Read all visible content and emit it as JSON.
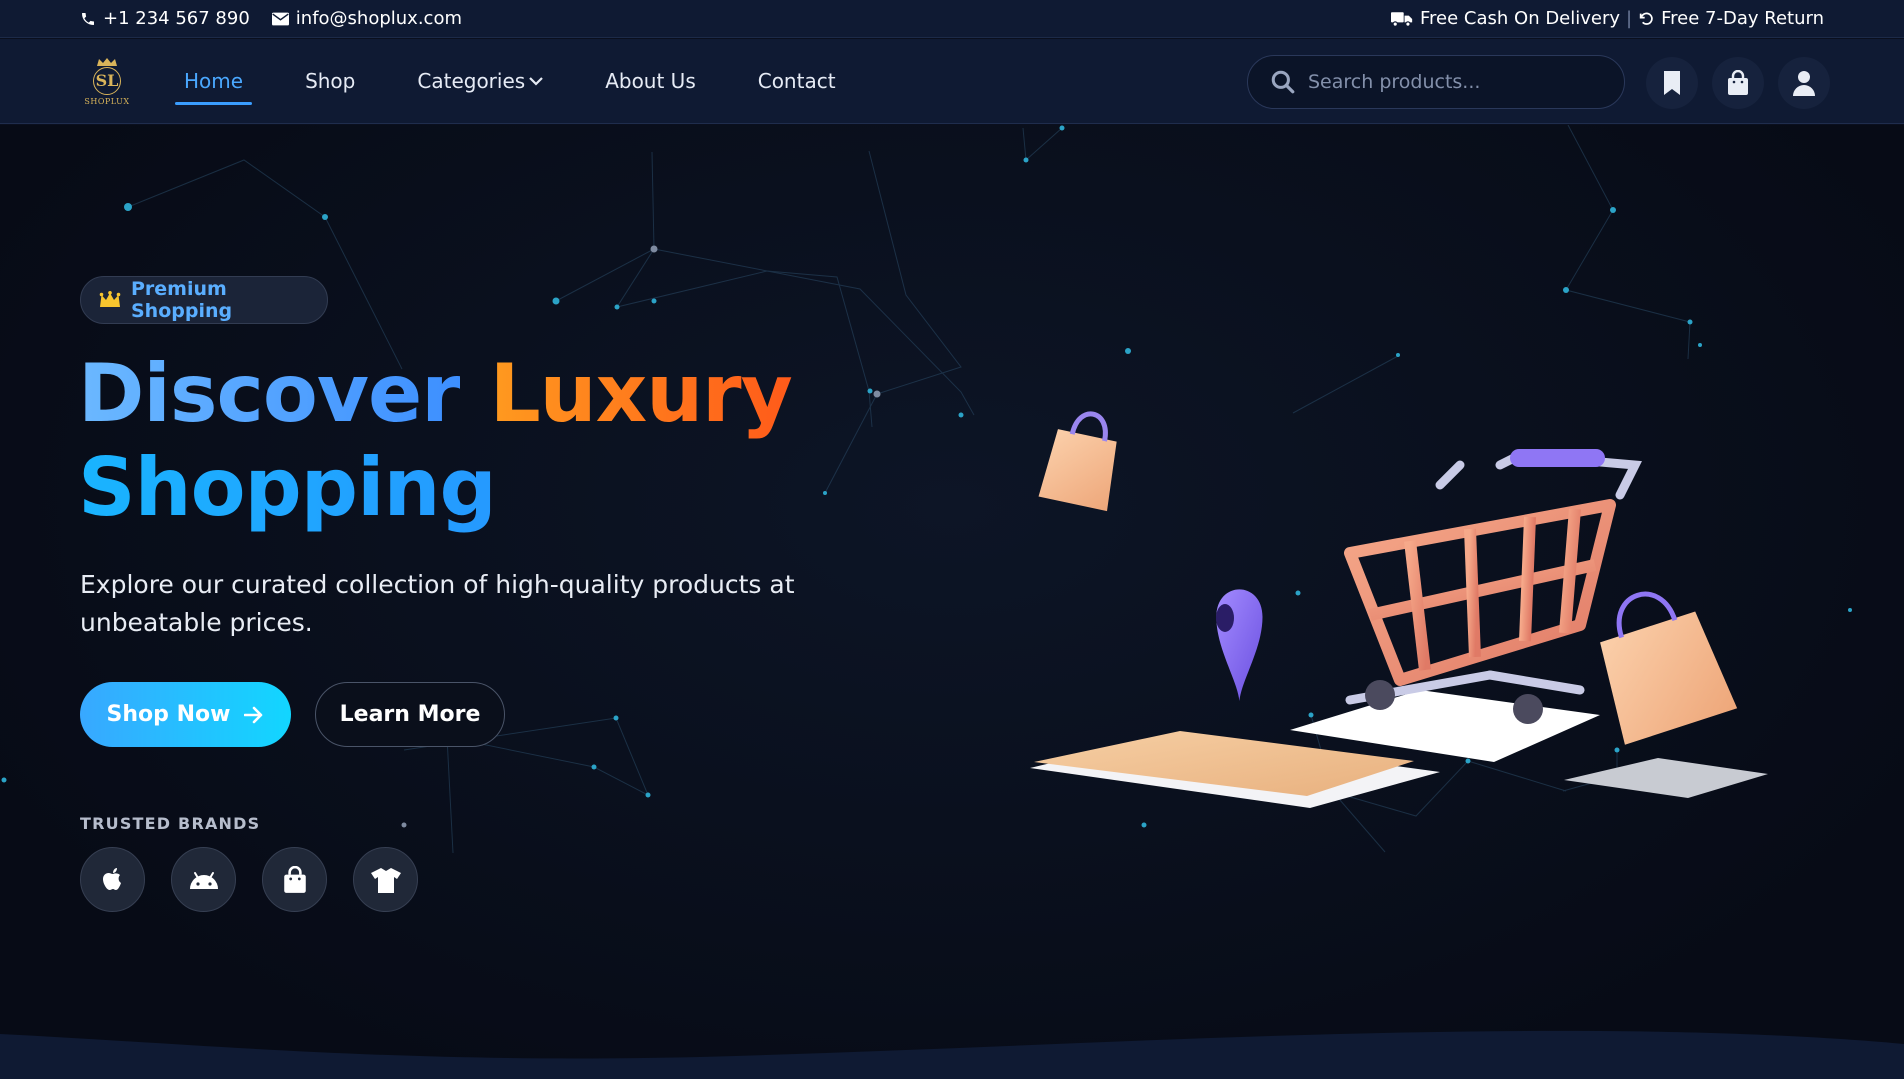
{
  "topbar": {
    "phone": "+1 234 567 890",
    "email": "info@shoplux.com",
    "delivery": "Free Cash On Delivery",
    "divider": "|",
    "return": "Free 7-Day Return"
  },
  "brand": {
    "logo_mark": "SL",
    "logo_text": "SHOPLUX"
  },
  "nav": {
    "items": [
      {
        "label": "Home",
        "active": true
      },
      {
        "label": "Shop"
      },
      {
        "label": "Categories",
        "has_dropdown": true
      },
      {
        "label": "About Us"
      },
      {
        "label": "Contact"
      }
    ],
    "search_placeholder": "Search products...",
    "icons": [
      "bookmark-icon",
      "shopping-bag-icon",
      "user-icon"
    ]
  },
  "hero": {
    "badge": "Premium Shopping",
    "title_word1": "Discover",
    "title_word2": "Luxury",
    "title_word3": "Shopping",
    "description": "Explore our curated collection of high-quality products at unbeatable prices.",
    "primary_button": "Shop Now",
    "secondary_button": "Learn More",
    "trusted_label": "TRUSTED BRANDS",
    "brand_icons": [
      "apple-icon",
      "android-icon",
      "shopping-bag-icon",
      "tshirt-icon"
    ]
  },
  "colors": {
    "accent_blue": "#3a9dff",
    "accent_orange": "#ff7a1a",
    "background": "#070b16",
    "header": "#0f1a33"
  }
}
